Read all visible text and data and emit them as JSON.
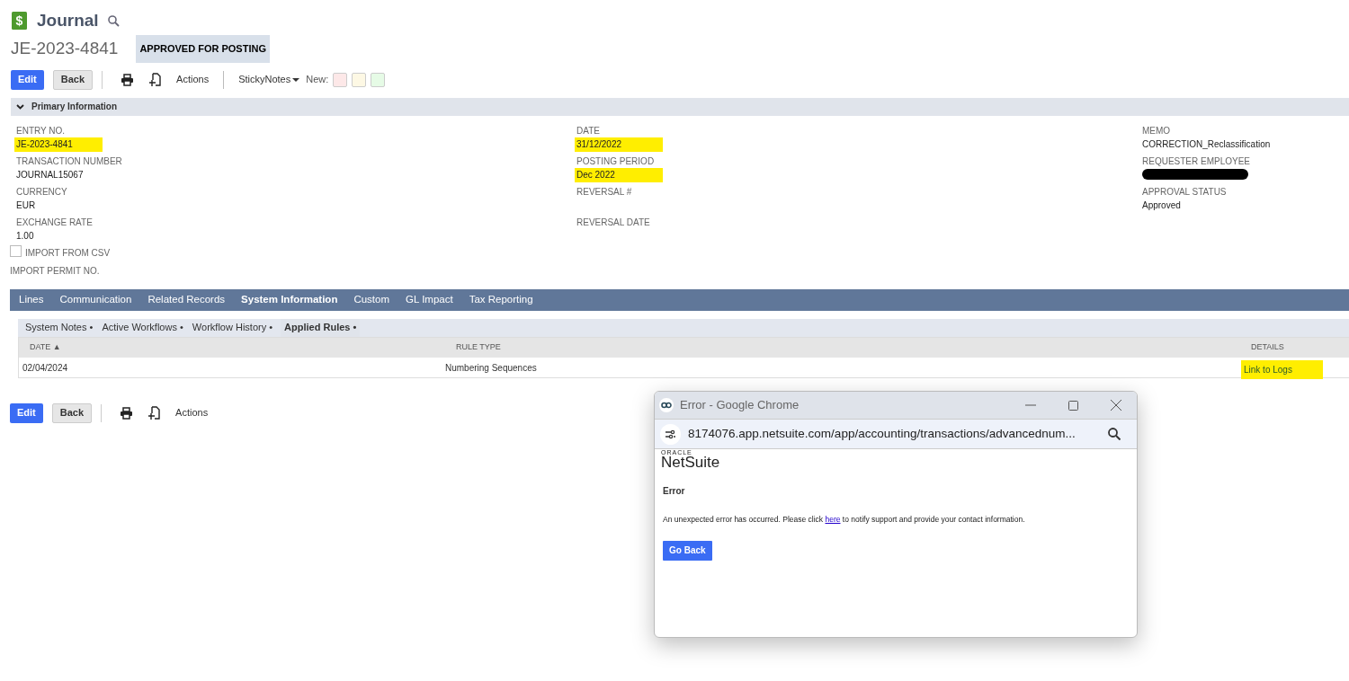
{
  "header": {
    "icon_glyph": "$",
    "title": "Journal",
    "record_id": "JE-2023-4841",
    "status": "APPROVED FOR POSTING"
  },
  "toolbar": {
    "buttons": [
      {
        "label": "Edit",
        "kind": "primary"
      },
      {
        "label": "Back",
        "kind": "secondary"
      }
    ],
    "actions": "Actions",
    "sticky_notes": "StickyNotes",
    "new_label": "New:",
    "note_colors": [
      {
        "color": "#fde8e8"
      },
      {
        "color": "#fdf8e4"
      },
      {
        "color": "#e6fbe6"
      }
    ]
  },
  "section": {
    "title": "Primary Information",
    "expanded": true
  },
  "fields": [
    [
      {
        "label": "ENTRY NO.",
        "value": "JE-2023-4841",
        "highlighted": true
      },
      {
        "label": "TRANSACTION NUMBER",
        "value": "JOURNAL15067",
        "highlighted": false
      },
      {
        "label": "CURRENCY",
        "value": "EUR",
        "highlighted": false
      },
      {
        "label": "EXCHANGE RATE",
        "value": "1.00",
        "highlighted": false
      }
    ],
    [
      {
        "label": "DATE",
        "value": "31/12/2022",
        "highlighted": true
      },
      {
        "label": "POSTING PERIOD",
        "value": "Dec 2022",
        "highlighted": true
      },
      {
        "label": "REVERSAL #"
      },
      {
        "label": "REVERSAL DATE"
      }
    ],
    [
      {
        "label": "MEMO",
        "value": "CORRECTION_Reclassification",
        "highlighted": false
      },
      {
        "label": "REQUESTER EMPLOYEE",
        "redacted": true
      },
      {
        "label": "APPROVAL STATUS",
        "value": "Approved",
        "highlighted": false
      }
    ]
  ],
  "import_csv": {
    "label": "IMPORT FROM CSV",
    "checked": false
  },
  "import_permit": {
    "label": "IMPORT PERMIT NO."
  },
  "tabs": [
    {
      "label": "Lines",
      "selected": false
    },
    {
      "label": "Communication",
      "selected": false
    },
    {
      "label": "Related Records",
      "selected": false
    },
    {
      "label": "System Information",
      "selected": true
    },
    {
      "label": "Custom",
      "selected": false
    },
    {
      "label": "GL Impact",
      "selected": false
    },
    {
      "label": "Tax Reporting",
      "selected": false
    }
  ],
  "subtabs": [
    {
      "label": "System Notes",
      "marker": "•",
      "selected": false
    },
    {
      "label": "Active Workflows",
      "marker": "•",
      "selected": false
    },
    {
      "label": "Workflow History",
      "marker": "•",
      "selected": false
    },
    {
      "label": "Applied Rules",
      "marker": "•",
      "selected": true
    }
  ],
  "table": {
    "columns": [
      {
        "label": "DATE",
        "sort": "▲"
      },
      {
        "label": "RULE TYPE"
      },
      {
        "label": "DETAILS"
      }
    ],
    "rows": [
      {
        "date": "02/04/2024",
        "rule_type": "Numbering Sequences",
        "details": "Link to Logs",
        "highlighted": true
      }
    ]
  },
  "bottom_toolbar": {
    "buttons": [
      {
        "label": "Edit",
        "kind": "primary"
      },
      {
        "label": "Back",
        "kind": "secondary"
      }
    ],
    "actions": "Actions"
  },
  "popup": {
    "title": "Error - Google Chrome",
    "url": "8174076.app.netsuite.com/app/accounting/transactions/advancednum...",
    "logo_top": "ORACLE",
    "logo_bottom": "NetSuite",
    "heading": "Error",
    "message_before": "An unexpected error has occurred. Please click ",
    "link": "here",
    "message_after": " to notify support and provide your contact information.",
    "button": "Go Back"
  }
}
